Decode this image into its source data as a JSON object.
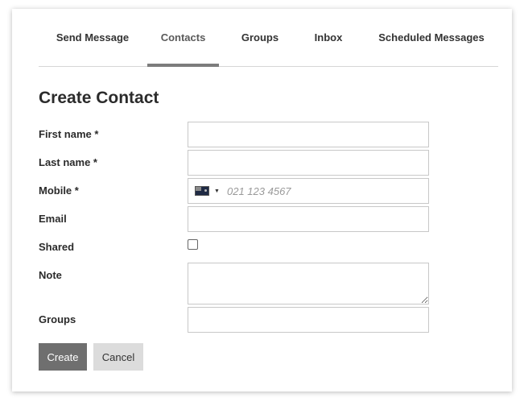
{
  "tabs": [
    {
      "label": "Send Message"
    },
    {
      "label": "Contacts"
    },
    {
      "label": "Groups"
    },
    {
      "label": "Inbox"
    },
    {
      "label": "Scheduled Messages"
    }
  ],
  "page_title": "Create Contact",
  "form": {
    "first_name_label": "First name *",
    "last_name_label": "Last name *",
    "mobile_label": "Mobile *",
    "mobile_placeholder": "021 123 4567",
    "country_caret": "▼",
    "email_label": "Email",
    "shared_label": "Shared",
    "note_label": "Note",
    "groups_label": "Groups"
  },
  "buttons": {
    "create_label": "Create",
    "cancel_label": "Cancel"
  }
}
